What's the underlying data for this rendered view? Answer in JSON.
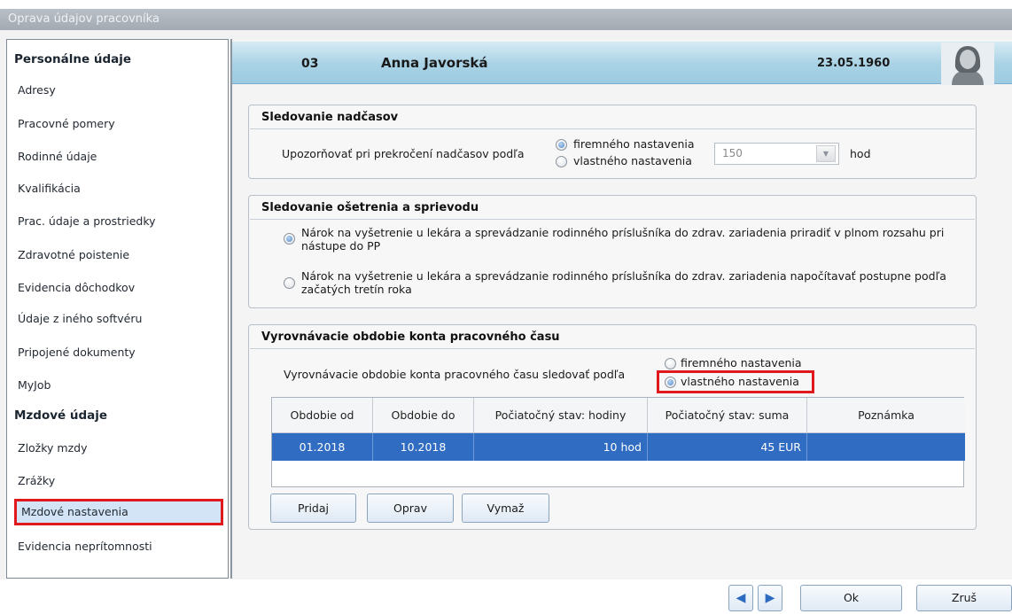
{
  "window": {
    "title": "Oprava údajov pracovníka"
  },
  "sidebar": {
    "section1": "Personálne údaje",
    "items1": [
      "Adresy",
      "Pracovné pomery",
      "Rodinné údaje",
      "Kvalifikácia",
      "Prac. údaje a prostriedky",
      "Zdravotné poistenie",
      "Evidencia dôchodkov",
      "Údaje z iného softvéru",
      "Pripojené dokumenty",
      "MyJob"
    ],
    "section2": "Mzdové údaje",
    "items2": [
      "Zložky mzdy",
      "Zrážky",
      "Mzdové nastavenia",
      "Evidencia neprítomnosti"
    ],
    "selected": "Mzdové nastavenia"
  },
  "header": {
    "number": "03",
    "name": "Anna Javorská",
    "date": "23.05.1960"
  },
  "overtime": {
    "title": "Sledovanie nadčasov",
    "label": "Upozorňovať pri prekročení nadčasov podľa",
    "option_company": "firemného nastavenia",
    "option_own": "vlastného nastavenia",
    "selected": "company",
    "value": "150",
    "unit": "hod"
  },
  "treatment": {
    "title": "Sledovanie ošetrenia a sprievodu",
    "option1": "Nárok na vyšetrenie u lekára a sprevádzanie rodinného príslušníka do zdrav. zariadenia priradiť v plnom rozsahu pri nástupe do PP",
    "option2": "Nárok na vyšetrenie u lekára a sprevádzanie rodinného príslušníka do zdrav. zariadenia napočítavať postupne podľa začatých tretín roka",
    "selected": 1
  },
  "balance": {
    "title": "Vyrovnávacie obdobie konta pracovného času",
    "label": "Vyrovnávacie obdobie konta pracovného času sledovať podľa",
    "option_company": "firemného nastavenia",
    "option_own": "vlastného nastavenia",
    "selected": "own",
    "columns": [
      "Obdobie od",
      "Obdobie do",
      "Počiatočný stav: hodiny",
      "Počiatočný stav: suma",
      "Poznámka"
    ],
    "rows": [
      {
        "from": "01.2018",
        "to": "10.2018",
        "hours": "10 hod",
        "sum": "45 EUR",
        "note": ""
      }
    ],
    "buttons": {
      "add": "Pridaj",
      "edit": "Oprav",
      "delete": "Vymaž"
    }
  },
  "footer": {
    "prev_icon": "◀",
    "next_icon": "▶",
    "ok": "Ok",
    "cancel": "Zruš"
  }
}
